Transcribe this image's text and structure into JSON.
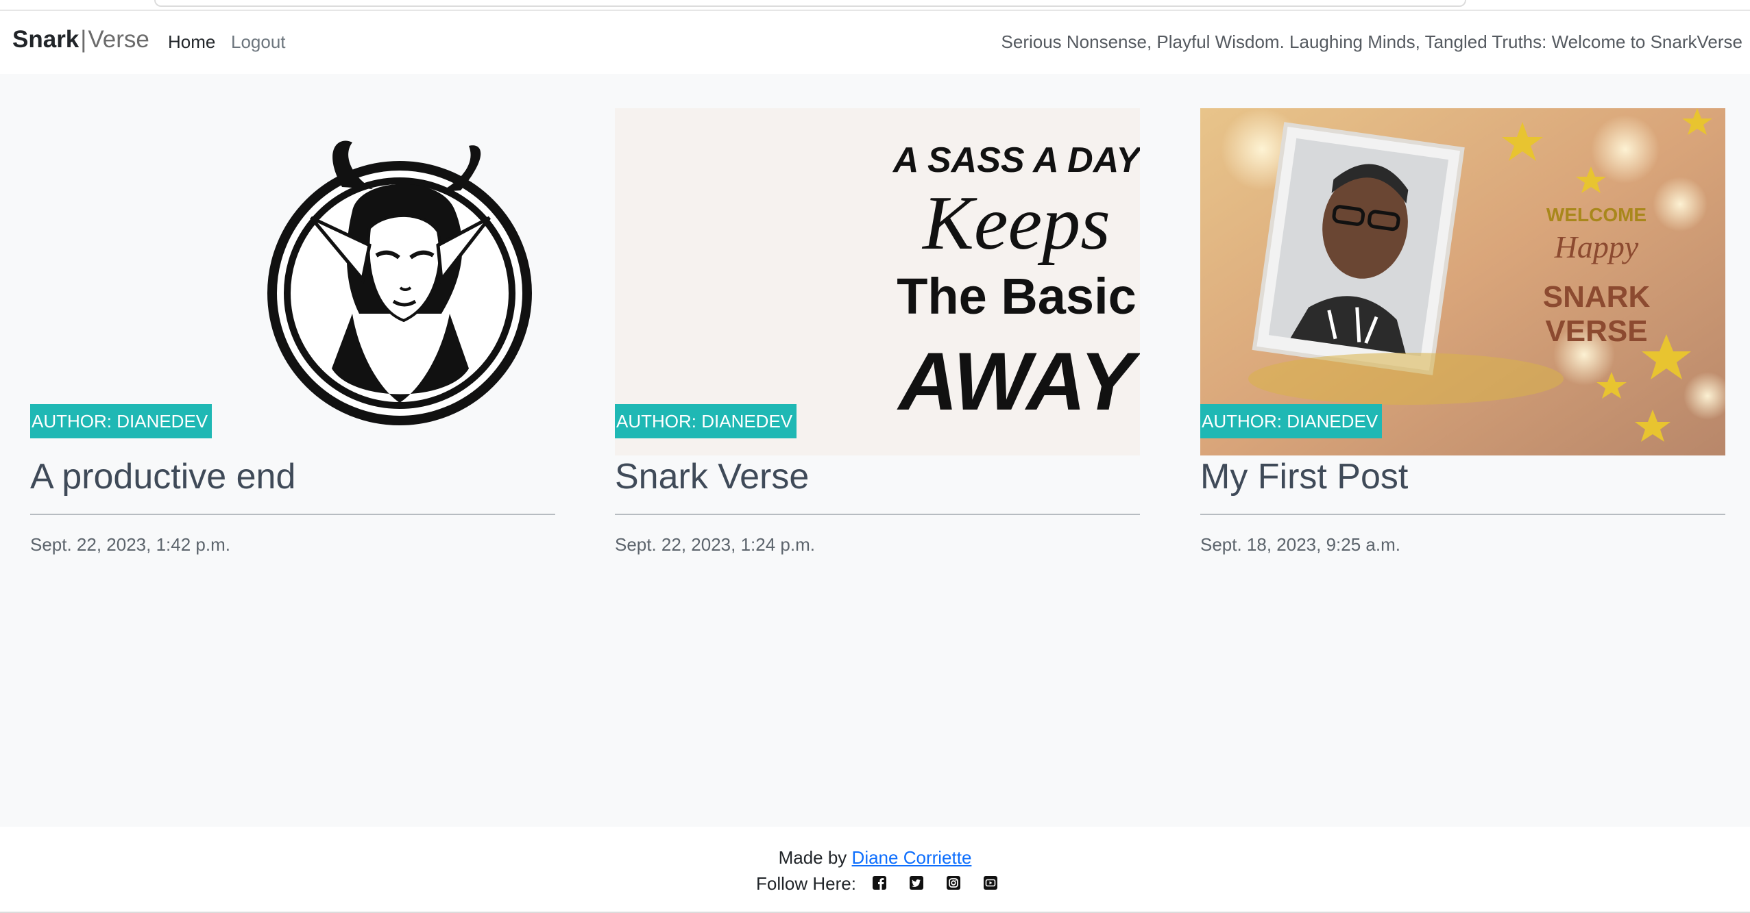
{
  "navbar": {
    "brand_bold": "Snark",
    "brand_separator": "|",
    "brand_light": "Verse",
    "links": [
      "Home",
      "Logout"
    ],
    "tagline": "Serious Nonsense, Playful Wisdom. Laughing Minds, Tangled Truths: Welcome to SnarkVerse"
  },
  "posts": [
    {
      "author": "AUTHOR: DIANEDEV",
      "title": "A productive end",
      "date": "Sept. 22, 2023, 1:42 p.m.",
      "image": "horned-girl-emblem"
    },
    {
      "author": "AUTHOR: DIANEDEV",
      "title": "Snark Verse",
      "date": "Sept. 22, 2023, 1:24 p.m.",
      "image": "sass-quote-typography",
      "image_text": [
        "A SASS A DAY",
        "Keeps",
        "The Basic",
        "AWAY"
      ]
    },
    {
      "author": "AUTHOR: DIANEDEV",
      "title": "My First Post",
      "date": "Sept. 18, 2023, 9:25 a.m.",
      "image": "welcome-photo-collage",
      "image_text": [
        "WELCOME",
        "Happy",
        "SNARK",
        "VERSE"
      ]
    }
  ],
  "footer": {
    "made_by": "Made by",
    "author_link": "Diane Corriette",
    "follow_label": "Follow Here:",
    "social_icons": [
      "facebook-icon",
      "twitter-icon",
      "instagram-icon",
      "youtube-icon"
    ]
  },
  "colors": {
    "accent": "#1fb8b4",
    "link": "#0d6efd",
    "page_bg": "#f8f9fa",
    "title": "#3f4a58"
  }
}
